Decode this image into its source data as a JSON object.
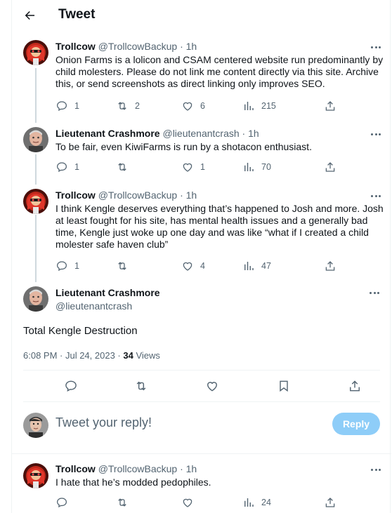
{
  "header": {
    "title": "Tweet"
  },
  "tweets": [
    {
      "name": "Trollcow",
      "handle": "@TrollcowBackup",
      "time": "· 1h",
      "text": "Onion Farms is a lolicon and CSAM centered website run predominantly by child molesters. Please do not link me content directly via this site. Archive this, or send screenshots as direct linking only improves SEO.",
      "replies": "1",
      "retweets": "2",
      "likes": "6",
      "views": "215"
    },
    {
      "name": "Lieutenant Crashmore",
      "handle": "@lieutenantcrash",
      "time": "· 1h",
      "text": "To be fair, even KiwiFarms is run by a shotacon enthusiast.",
      "replies": "1",
      "retweets": "",
      "likes": "1",
      "views": "70"
    },
    {
      "name": "Trollcow",
      "handle": "@TrollcowBackup",
      "time": "· 1h",
      "text": "I think Kengle deserves everything that’s happened to Josh and more. Josh at least fought for his site, has mental health issues and a generally bad time, Kengle just woke up one day and was like “what if I created a child molester safe haven club”",
      "replies": "1",
      "retweets": "",
      "likes": "4",
      "views": "47"
    }
  ],
  "focus": {
    "name": "Lieutenant Crashmore",
    "handle": "@lieutenantcrash",
    "text": "Total Kengle Destruction",
    "timestamp": "6:08 PM · Jul 24, 2023 · ",
    "views_count": "34",
    "views_label": " Views"
  },
  "composer": {
    "placeholder": "Tweet your reply!",
    "button_label": "Reply"
  },
  "reply": {
    "name": "Trollcow",
    "handle": "@TrollcowBackup",
    "time": "· 1h",
    "text": "I hate that he’s modded pedophiles.",
    "replies": "",
    "retweets": "",
    "likes": "",
    "views": "24"
  },
  "icons": {
    "back": "arrow-left-icon",
    "more": "more-dots-icon",
    "reply": "reply-bubble-icon",
    "retweet": "retweet-icon",
    "like": "heart-icon",
    "views": "views-bar-icon",
    "share": "share-icon",
    "bookmark": "bookmark-icon"
  },
  "colors": {
    "text": "#0f1419",
    "muted": "#536471",
    "reply_button": "#8ecdf8",
    "thread_line": "#cfd9de"
  }
}
